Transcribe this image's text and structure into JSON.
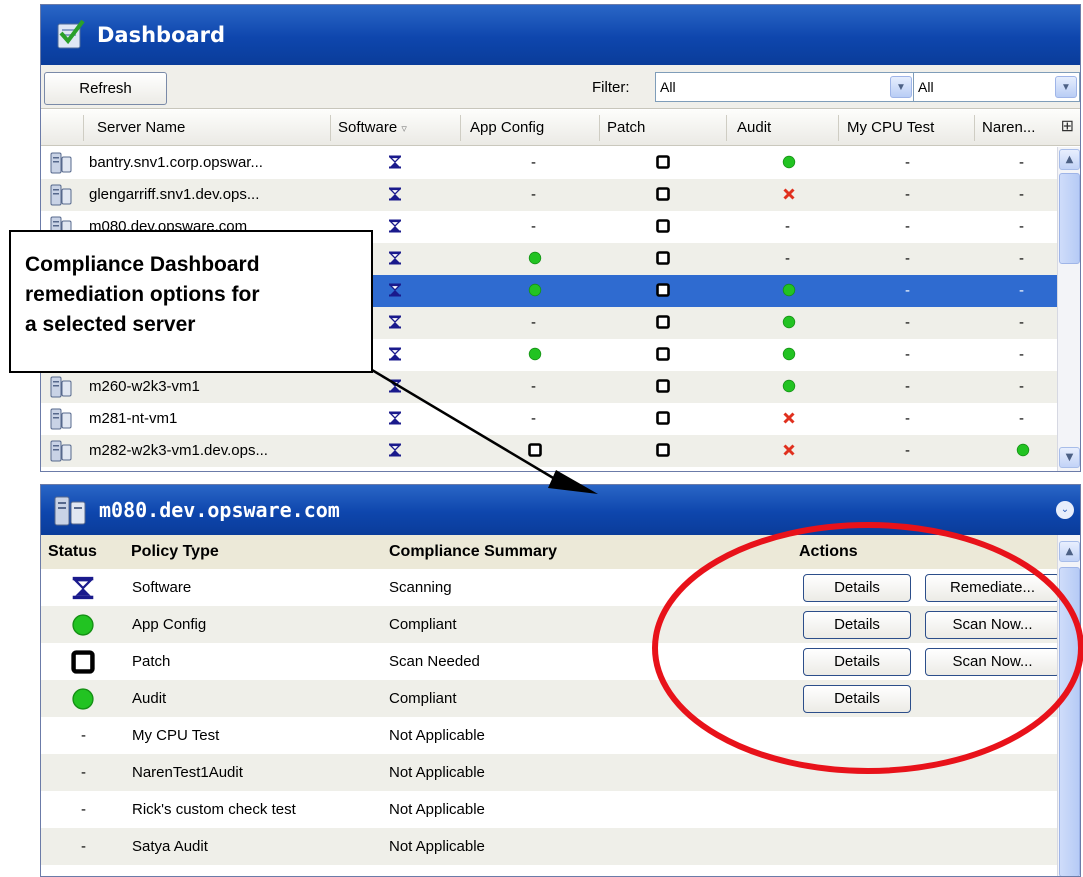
{
  "dashboard": {
    "title": "Dashboard",
    "refresh_label": "Refresh",
    "filter_label": "Filter:",
    "filter1_value": "All",
    "filter2_value": "All",
    "columns": [
      "Server Name",
      "Software",
      "App Config",
      "Patch",
      "Audit",
      "My CPU Test",
      "Naren..."
    ],
    "rows": [
      {
        "server": "bantry.snv1.corp.opswar...",
        "software": "hourglass",
        "app": "-",
        "patch": "square",
        "audit": "green",
        "cpu": "-",
        "naren": "-"
      },
      {
        "server": "glengarriff.snv1.dev.ops...",
        "software": "hourglass",
        "app": "-",
        "patch": "square",
        "audit": "red-x",
        "cpu": "-",
        "naren": "-"
      },
      {
        "server": "m080.dev.opsware.com",
        "software": "hourglass",
        "app": "-",
        "patch": "square",
        "audit": "-",
        "cpu": "-",
        "naren": "-"
      },
      {
        "server": "",
        "software": "hourglass",
        "app": "green",
        "patch": "square",
        "audit": "-",
        "cpu": "-",
        "naren": "-"
      },
      {
        "server": "",
        "software": "hourglass",
        "app": "green",
        "patch": "square",
        "audit": "green",
        "cpu": "-",
        "naren": "-",
        "selected": true
      },
      {
        "server": "",
        "software": "hourglass",
        "app": "-",
        "patch": "square",
        "audit": "green",
        "cpu": "-",
        "naren": "-"
      },
      {
        "server": "",
        "software": "hourglass",
        "app": "green",
        "patch": "square",
        "audit": "green",
        "cpu": "-",
        "naren": "-"
      },
      {
        "server": "m260-w2k3-vm1",
        "software": "hourglass",
        "app": "-",
        "patch": "square",
        "audit": "green",
        "cpu": "-",
        "naren": "-"
      },
      {
        "server": "m281-nt-vm1",
        "software": "hourglass",
        "app": "-",
        "patch": "square",
        "audit": "red-x",
        "cpu": "-",
        "naren": "-"
      },
      {
        "server": "m282-w2k3-vm1.dev.ops...",
        "software": "hourglass",
        "app": "square",
        "patch": "square",
        "audit": "red-x",
        "cpu": "-",
        "naren": "green"
      }
    ]
  },
  "detail": {
    "title": "m080.dev.opsware.com",
    "headers": {
      "status": "Status",
      "policy": "Policy Type",
      "summary": "Compliance Summary",
      "actions": "Actions"
    },
    "rows": [
      {
        "status": "hourglass",
        "policy": "Software",
        "summary": "Scanning",
        "actions": [
          "Details",
          "Remediate..."
        ]
      },
      {
        "status": "green",
        "policy": "App Config",
        "summary": "Compliant",
        "actions": [
          "Details",
          "Scan Now..."
        ]
      },
      {
        "status": "square",
        "policy": "Patch",
        "summary": "Scan Needed",
        "actions": [
          "Details",
          "Scan Now..."
        ]
      },
      {
        "status": "green",
        "policy": "Audit",
        "summary": "Compliant",
        "actions": [
          "Details"
        ]
      },
      {
        "status": "-",
        "policy": "My CPU Test",
        "summary": "Not Applicable",
        "actions": []
      },
      {
        "status": "-",
        "policy": "NarenTest1Audit",
        "summary": "Not Applicable",
        "actions": []
      },
      {
        "status": "-",
        "policy": "Rick's custom check test",
        "summary": "Not Applicable",
        "actions": []
      },
      {
        "status": "-",
        "policy": "Satya Audit",
        "summary": "Not Applicable",
        "actions": []
      }
    ]
  },
  "annotation": {
    "callout_lines": [
      "Compliance Dashboard",
      "remediation options for",
      "a selected server"
    ]
  },
  "colors": {
    "title_blue": "#0e46ad",
    "selected_row": "#2f6bd0",
    "status_green": "#22c322",
    "status_red": "#e0301e",
    "highlight_ellipse": "#e8121a"
  }
}
